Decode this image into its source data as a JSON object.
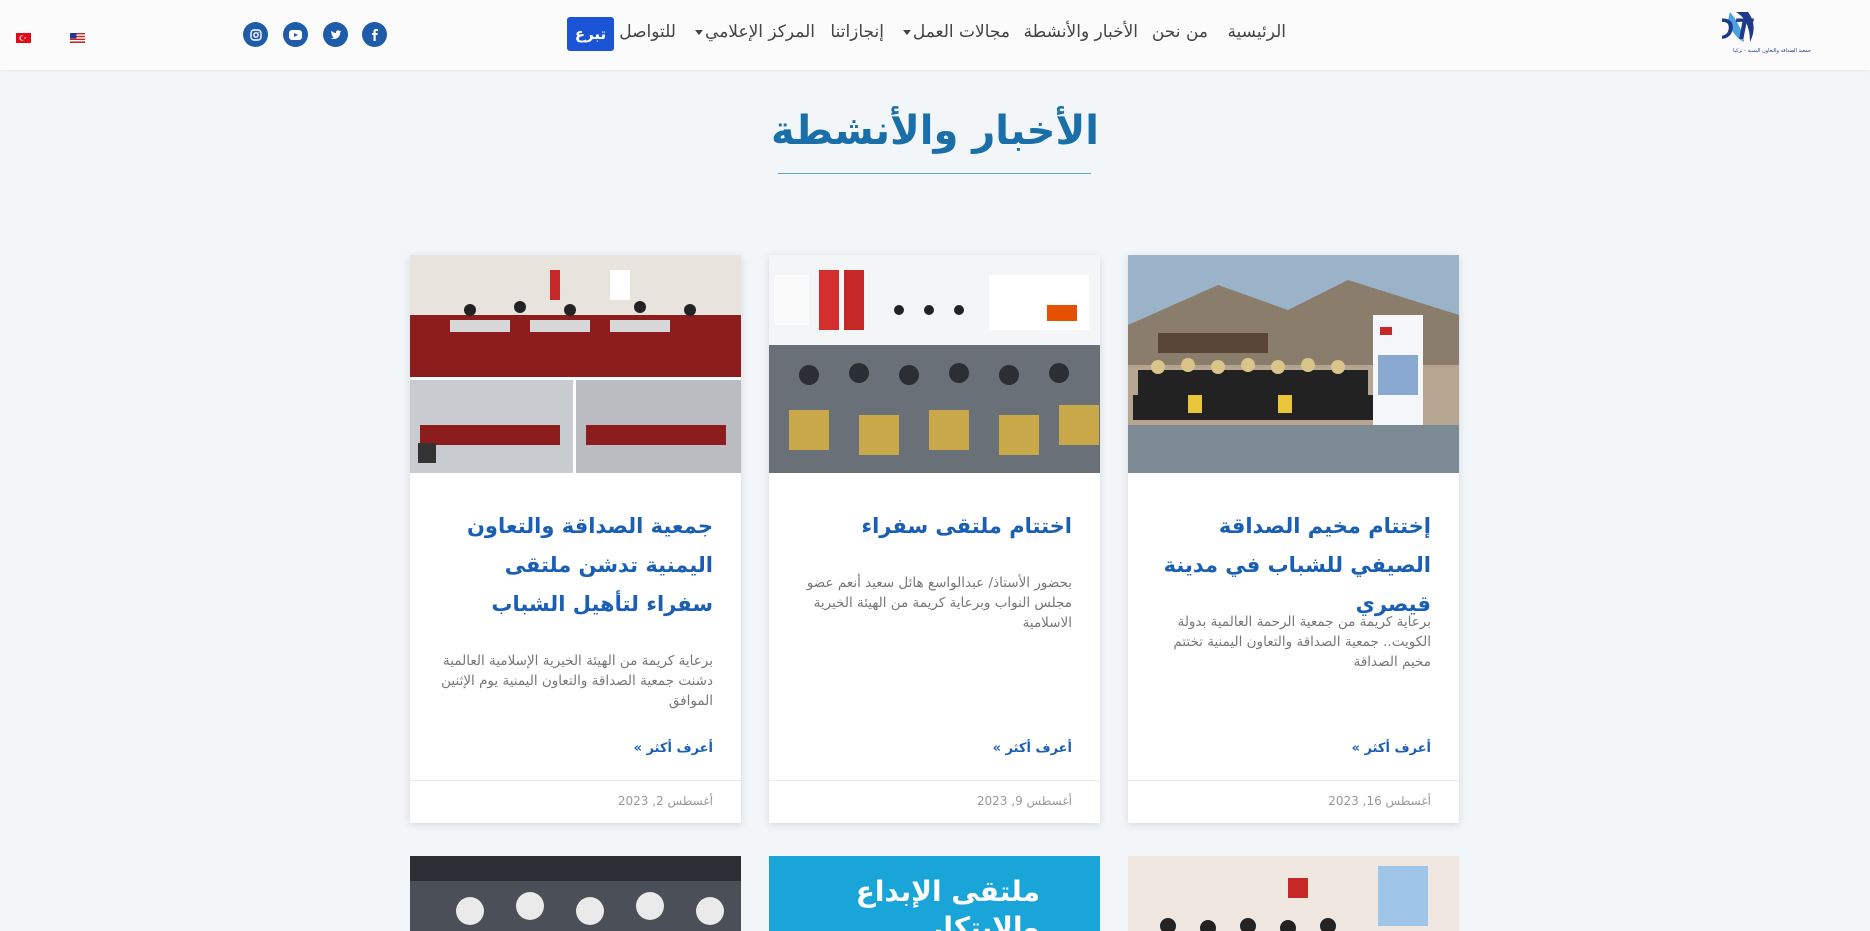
{
  "brand": {
    "logo_text": "YDT",
    "caption": "جمعية الصداقة والتعاون اليمنية - تركيا",
    "colors": {
      "primary": "#1a6fa8",
      "button": "#1b54d6",
      "social": "#1e5ba8"
    }
  },
  "nav": {
    "home": "الرئيسية",
    "about": "من نحن",
    "news": "الأخبار والأنشطة",
    "fields": "مجالات العمل",
    "achievements": "إنجازاتنا",
    "media": "المركز الإعلامي",
    "contact": "للتواصل",
    "donate": "تبرع"
  },
  "social": [
    "facebook-icon",
    "twitter-icon",
    "youtube-icon",
    "instagram-icon"
  ],
  "languages": [
    "us-flag-icon",
    "turkey-flag-icon"
  ],
  "page": {
    "title": "الأخبار والأنشطة"
  },
  "posts": [
    {
      "title": "إختتام مخيم الصداقة الصيفي للشباب في مدينة قيصري",
      "excerpt": "برعاية كريمة من جمعية الرحمة العالمية بدولة الكويت.. جمعية الصداقة والتعاون اليمنية تختتم مخيم الصداقة",
      "more": "أعرف أكثر »",
      "date": "أغسطس 16, 2023"
    },
    {
      "title": "اختتام ملتقى سفراء",
      "excerpt": "بحضور الأستاذ/ عبدالواسع هائل سعيد أنعم عضو مجلس النواب وبرعاية كريمة من الهيئة الخيرية الاسلامية",
      "more": "أعرف أكثر »",
      "date": "أغسطس 9, 2023"
    },
    {
      "title": "جمعية الصداقة والتعاون اليمنية تدشن ملتقى سفراء لتأهيل الشباب",
      "excerpt": "برعاية كريمة من الهيئة الخيرية الإسلامية العالمية دشنت جمعية الصداقة والتعاون اليمنية يوم الإثنين الموافق",
      "more": "أعرف أكثر »",
      "date": "أغسطس 2, 2023"
    }
  ],
  "next_row": {
    "banner_text": "ملتقى الإبداع والابتكار"
  }
}
